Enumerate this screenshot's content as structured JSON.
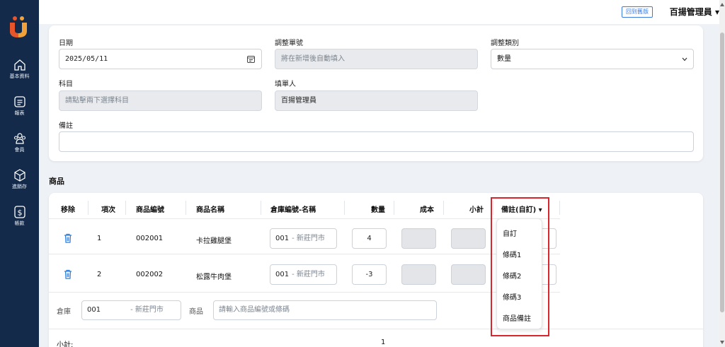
{
  "sidebar": {
    "items": [
      {
        "label": "基本資料",
        "icon": "home-icon"
      },
      {
        "label": "報表",
        "icon": "report-icon"
      },
      {
        "label": "會員",
        "icon": "members-icon"
      },
      {
        "label": "進銷存",
        "icon": "inventory-icon"
      },
      {
        "label": "帳款",
        "icon": "dollar-icon"
      }
    ]
  },
  "header": {
    "old_version_label": "回到舊版",
    "user_name": "百揚管理員 ▾"
  },
  "form": {
    "date_label": "日期",
    "date_value": "2025/05/11",
    "adjust_no_label": "調整單號",
    "adjust_no_placeholder": "將在新增後自動填入",
    "adjust_type_label": "調整類別",
    "adjust_type_value": "數量",
    "subject_label": "科目",
    "subject_placeholder": "請點擊兩下選擇科目",
    "filler_label": "填單人",
    "filler_value": "百揚管理員",
    "note_label": "備註",
    "note_value": ""
  },
  "products": {
    "section_title": "商品",
    "columns": [
      "移除",
      "項次",
      "商品編號",
      "商品名稱",
      "倉庫編號-名稱",
      "數量",
      "成本",
      "小計",
      "備註(自訂) ▾"
    ],
    "rows": [
      {
        "index": "1",
        "code": "002001",
        "name": "卡拉雞腿堡",
        "warehouse_code": "001",
        "warehouse_name": "- 新莊門市",
        "qty": "4"
      },
      {
        "index": "2",
        "code": "002002",
        "name": "松露牛肉堡",
        "warehouse_code": "001",
        "warehouse_name": "- 新莊門市",
        "qty": "-3"
      }
    ],
    "add_row": {
      "warehouse_label": "倉庫",
      "warehouse_code": "001",
      "warehouse_name": "- 新莊門市",
      "product_label": "商品",
      "product_placeholder": "請輸入商品編號或條碼"
    },
    "subtotal_label": "小計:",
    "subtotal_qty": "1"
  },
  "note_dropdown": {
    "options": [
      "自訂",
      "條碼1",
      "條碼2",
      "條碼3",
      "商品備註"
    ]
  },
  "colors": {
    "sidebar": "#132a4a",
    "accent": "#3b7be0",
    "highlight": "#d9262c"
  }
}
